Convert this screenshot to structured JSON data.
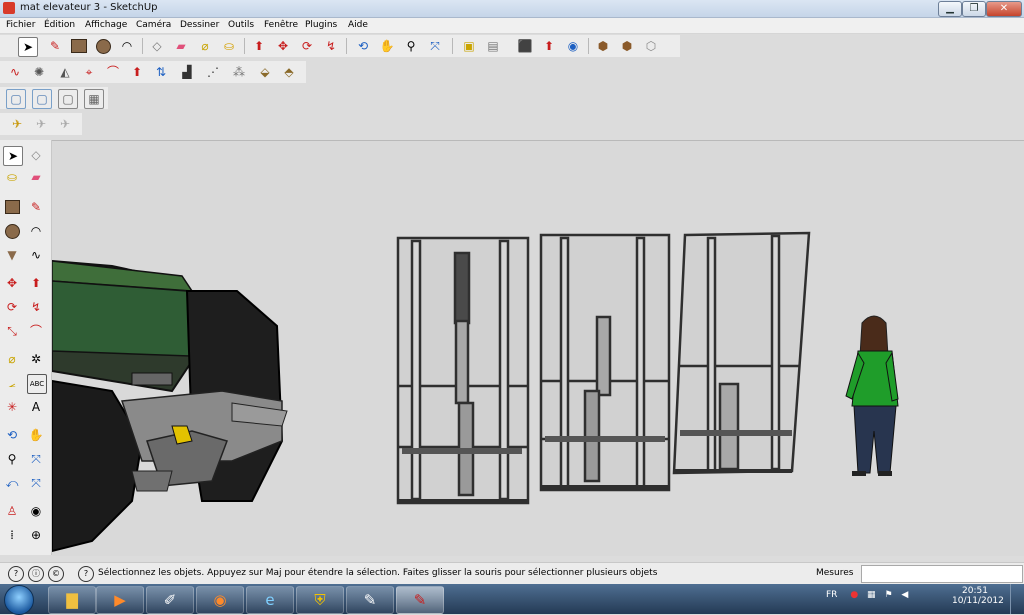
{
  "window": {
    "title": "mat elevateur 3 - SketchUp",
    "controls": [
      "minimize-icon",
      "maximize-icon",
      "close-icon"
    ]
  },
  "menu": [
    "Fichier",
    "Édition",
    "Affichage",
    "Caméra",
    "Dessiner",
    "Outils",
    "Fenêtre",
    "Plugins",
    "Aide"
  ],
  "toolbars": {
    "main": [
      "select",
      "line",
      "rectangle",
      "circle",
      "arc",
      "make-component",
      "eraser",
      "tape-measure",
      "paint-bucket",
      "push-pull",
      "move",
      "rotate",
      "follow-me",
      "orbit",
      "pan",
      "zoom",
      "zoom-extents",
      "add-location",
      "toggle-terrain",
      "photo-textures",
      "get-models",
      "share-model",
      "3d-warehouse",
      "get-photo",
      "share-component"
    ],
    "sandbox": [
      "smoove",
      "from-contours",
      "from-scratch",
      "stamp",
      "drape",
      "add-detail",
      "flip-edge",
      "sandbox-a",
      "sandbox-b",
      "sandbox-c",
      "sandbox-d"
    ],
    "views": [
      "top-view",
      "front-view",
      "right-view",
      "iso-view"
    ],
    "extra": [
      "place-figure",
      "figure-b",
      "figure-c"
    ]
  },
  "left_tools": [
    "select",
    "make-component",
    "paint-bucket",
    "eraser",
    "rectangle",
    "line",
    "circle",
    "arc",
    "polygon",
    "freehand",
    "move",
    "push-pull",
    "rotate",
    "follow-me",
    "scale",
    "offset",
    "tape-measure",
    "dimension",
    "protractor",
    "text",
    "axes",
    "3d-text",
    "orbit",
    "pan",
    "zoom",
    "zoom-window",
    "previous",
    "zoom-extents",
    "position-camera",
    "look-around",
    "walk",
    "section-plane"
  ],
  "status": {
    "text": "Sélectionnez les objets. Appuyez sur Maj pour étendre la sélection. Faites glisser la souris pour sélectionner plusieurs objets",
    "measure_label": "Mesures",
    "measure_value": ""
  },
  "taskbar": {
    "apps": [
      "explorer",
      "media-player",
      "gimp",
      "firefox",
      "internet-explorer",
      "security",
      "paint",
      "sketchup"
    ],
    "language": "FR",
    "time": "20:51",
    "date": "10/11/2012"
  },
  "colors": {
    "viewport_bg": "#d9d9d9",
    "frame_edge": "#2f2f2f",
    "tractor_green": "#2f5d35",
    "person_shirt": "#1f9d2a"
  }
}
